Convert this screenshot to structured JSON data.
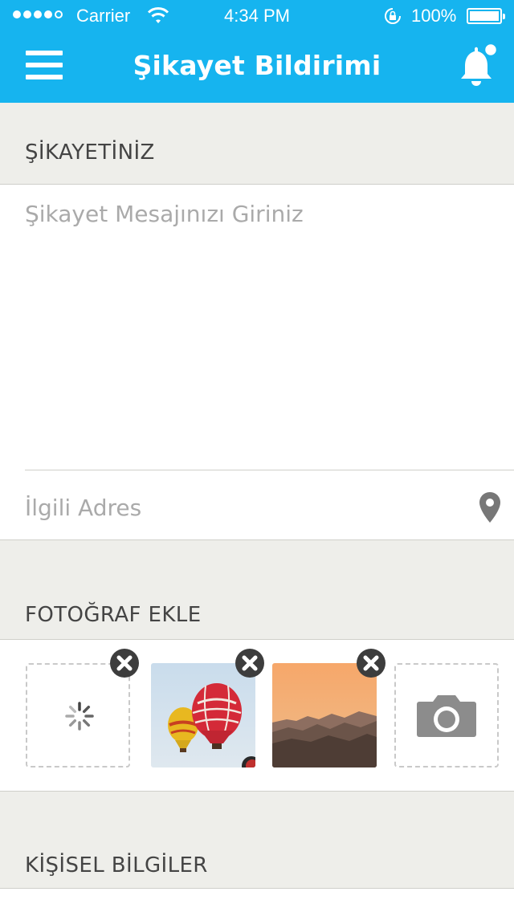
{
  "status_bar": {
    "carrier": "Carrier",
    "time": "4:34 PM",
    "battery": "100%",
    "signal_level": 4,
    "signal_max": 5
  },
  "header": {
    "title": "Şikayet Bildirimi",
    "menu_icon": "hamburger-menu-icon",
    "bell_icon": "notification-bell-icon",
    "has_unread_notification": true,
    "background_color": "#16b4ef"
  },
  "complaint": {
    "section_title": "ŞİKAYETİNİZ",
    "message_placeholder": "Şikayet Mesajınızı Giriniz",
    "address_placeholder": "İlgili Adres",
    "location_icon": "location-pin-icon"
  },
  "photos": {
    "section_title": "FOTOĞRAF EKLE",
    "items": [
      {
        "kind": "loading",
        "icon": "loading-spinner-icon",
        "removable": true
      },
      {
        "kind": "image",
        "subject": "hot-air-balloons",
        "removable": true
      },
      {
        "kind": "image",
        "subject": "sunset-mountains",
        "removable": true
      },
      {
        "kind": "add",
        "icon": "camera-icon",
        "removable": false
      }
    ],
    "remove_icon": "close-icon"
  },
  "personal": {
    "section_title": "KİŞİSEL BİLGİLER"
  }
}
